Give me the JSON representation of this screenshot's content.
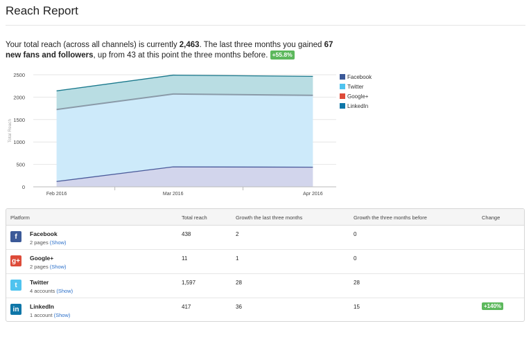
{
  "page": {
    "title": "Reach Report"
  },
  "summary": {
    "p1": "Your total reach (across all channels) is currently ",
    "total": "2,463",
    "p2": ". The last three months you gained ",
    "gained": "67 new fans and followers",
    "p3": ", up from 43 at this point the three months before. ",
    "badge": "+55.8%"
  },
  "colors": {
    "facebook": "#3b5998",
    "twitter": "#4fc3ef",
    "googleplus": "#dd4b39",
    "linkedin": "#0e76a8",
    "success": "#5cb85c",
    "link": "#2a6fc9"
  },
  "chart_data": {
    "type": "area",
    "stacked": true,
    "categories": [
      "Feb 2016",
      "Mar 2016",
      "Apr 2016"
    ],
    "x": [
      0.0,
      1.0,
      2.2
    ],
    "ylabel": "Total Reach",
    "xlabel": "",
    "ylim": [
      0,
      2500
    ],
    "yticks": [
      "0",
      "500",
      "1000",
      "1500",
      "2000",
      "2500"
    ],
    "grid": true,
    "legend_position": "right",
    "series": [
      {
        "name": "Facebook",
        "color": "#3b5998",
        "values": [
          120,
          445,
          438
        ]
      },
      {
        "name": "Twitter",
        "color": "#4fc3ef",
        "values": [
          1600,
          1620,
          1597
        ]
      },
      {
        "name": "Google+",
        "color": "#dd4b39",
        "values": [
          10,
          11,
          11
        ]
      },
      {
        "name": "LinkedIn",
        "color": "#0e76a8",
        "values": [
          410,
          415,
          417
        ]
      }
    ]
  },
  "table": {
    "headers": [
      "Platform",
      "Total reach",
      "Growth the last three months",
      "Growth the three months before",
      "Change"
    ],
    "rows": [
      {
        "icon": "facebook-icon",
        "glyph": "f",
        "name": "Facebook",
        "sub": "2 pages ",
        "show": "(Show)",
        "reach": "438",
        "growth_last": "2",
        "growth_before": "0",
        "change": ""
      },
      {
        "icon": "googleplus-icon",
        "glyph": "g+",
        "name": "Google+",
        "sub": "2 pages ",
        "show": "(Show)",
        "reach": "11",
        "growth_last": "1",
        "growth_before": "0",
        "change": ""
      },
      {
        "icon": "twitter-icon",
        "glyph": "t",
        "name": "Twitter",
        "sub": "4 accounts ",
        "show": "(Show)",
        "reach": "1,597",
        "growth_last": "28",
        "growth_before": "28",
        "change": ""
      },
      {
        "icon": "linkedin-icon",
        "glyph": "in",
        "name": "LinkedIn",
        "sub": "1 account ",
        "show": "(Show)",
        "reach": "417",
        "growth_last": "36",
        "growth_before": "15",
        "change": "+140%"
      }
    ]
  }
}
